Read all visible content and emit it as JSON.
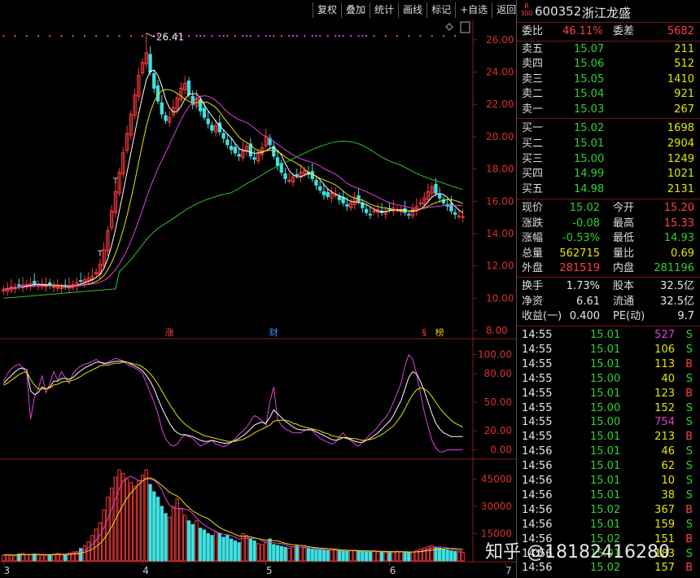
{
  "toolbar": [
    "复权",
    "叠加",
    "统计",
    "画线",
    "标记",
    "+自选",
    "返回"
  ],
  "stock": {
    "market_badge_top": "R",
    "market_badge_bottom": "300",
    "code": "600352",
    "name": "浙江龙盛"
  },
  "order_ratio": {
    "label": "委比",
    "value": "46.11%",
    "diff_label": "委差",
    "diff_value": "5682"
  },
  "asks": [
    {
      "label": "卖五",
      "price": "15.07",
      "vol": "211"
    },
    {
      "label": "卖四",
      "price": "15.06",
      "vol": "512"
    },
    {
      "label": "卖三",
      "price": "15.05",
      "vol": "1410"
    },
    {
      "label": "卖二",
      "price": "15.04",
      "vol": "921"
    },
    {
      "label": "卖一",
      "price": "15.03",
      "vol": "267"
    }
  ],
  "bids": [
    {
      "label": "买一",
      "price": "15.02",
      "vol": "1698"
    },
    {
      "label": "买二",
      "price": "15.01",
      "vol": "2904"
    },
    {
      "label": "买三",
      "price": "15.00",
      "vol": "1249"
    },
    {
      "label": "买四",
      "price": "14.99",
      "vol": "1021"
    },
    {
      "label": "买五",
      "price": "14.98",
      "vol": "2131"
    }
  ],
  "quote": [
    {
      "l1": "现价",
      "v1": "15.02",
      "c1": "green",
      "l2": "今开",
      "v2": "15.20",
      "c2": "red"
    },
    {
      "l1": "涨跌",
      "v1": "-0.08",
      "c1": "green",
      "l2": "最高",
      "v2": "15.33",
      "c2": "red"
    },
    {
      "l1": "涨幅",
      "v1": "-0.53%",
      "c1": "green",
      "l2": "最低",
      "v2": "14.93",
      "c2": "green"
    },
    {
      "l1": "总量",
      "v1": "562715",
      "c1": "yellow",
      "l2": "量比",
      "v2": "0.69",
      "c2": "yellow"
    },
    {
      "l1": "外盘",
      "v1": "281519",
      "c1": "red",
      "l2": "内盘",
      "v2": "281196",
      "c2": "green"
    }
  ],
  "fundamentals": [
    {
      "l1": "换手",
      "v1": "1.73%",
      "l2": "股本",
      "v2": "32.5亿"
    },
    {
      "l1": "净资",
      "v1": "6.61",
      "l2": "流通",
      "v2": "32.5亿"
    },
    {
      "l1": "收益(一)",
      "v1": "0.400",
      "l2": "PE(动)",
      "v2": "9.7"
    }
  ],
  "ticks": [
    {
      "t": "14:55",
      "p": "15.01",
      "v": "527",
      "vc": "magenta",
      "s": "S"
    },
    {
      "t": "14:55",
      "p": "15.01",
      "v": "106",
      "vc": "yellow",
      "s": "S"
    },
    {
      "t": "14:55",
      "p": "15.01",
      "v": "113",
      "vc": "yellow",
      "s": "B"
    },
    {
      "t": "14:55",
      "p": "15.00",
      "v": "40",
      "vc": "yellow",
      "s": "S"
    },
    {
      "t": "14:55",
      "p": "15.01",
      "v": "123",
      "vc": "yellow",
      "s": "B"
    },
    {
      "t": "14:55",
      "p": "15.00",
      "v": "152",
      "vc": "yellow",
      "s": "S"
    },
    {
      "t": "14:55",
      "p": "15.00",
      "v": "754",
      "vc": "magenta",
      "s": "S"
    },
    {
      "t": "14:55",
      "p": "15.01",
      "v": "213",
      "vc": "yellow",
      "s": "B"
    },
    {
      "t": "14:56",
      "p": "15.01",
      "v": "46",
      "vc": "yellow",
      "s": "S"
    },
    {
      "t": "14:56",
      "p": "15.01",
      "v": "62",
      "vc": "yellow",
      "s": "S"
    },
    {
      "t": "14:56",
      "p": "15.01",
      "v": "10",
      "vc": "yellow",
      "s": "S"
    },
    {
      "t": "14:56",
      "p": "15.01",
      "v": "38",
      "vc": "yellow",
      "s": "S"
    },
    {
      "t": "14:56",
      "p": "15.02",
      "v": "367",
      "vc": "yellow",
      "s": "B"
    },
    {
      "t": "14:56",
      "p": "15.01",
      "v": "159",
      "vc": "yellow",
      "s": "S"
    },
    {
      "t": "14:56",
      "p": "15.02",
      "v": "151",
      "vc": "yellow",
      "s": "B"
    },
    {
      "t": "14:56",
      "p": "15.01",
      "v": "183",
      "vc": "yellow",
      "s": "S"
    },
    {
      "t": "14:56",
      "p": "15.02",
      "v": "157",
      "vc": "yellow",
      "s": "B"
    }
  ],
  "watermark": "知乎 @18182416280",
  "colors": {
    "up": "#ff3a3a",
    "down": "#3ee0e0",
    "bid_green": "#2fd12f",
    "frame_red": "#8a1a1a",
    "ma5": "#ffffff",
    "ma10": "#e6e600",
    "ma20": "#e040e0",
    "ma60": "#2fc02f"
  },
  "chart_data": [
    {
      "type": "candlestick",
      "name": "price",
      "yticks": [
        "26.00",
        "24.00",
        "22.00",
        "20.00",
        "18.00",
        "16.00",
        "14.00",
        "12.00",
        "10.00",
        "8.00"
      ],
      "ylim": [
        7.6,
        27.2
      ],
      "x_labels": [
        "3",
        "4",
        "5",
        "6",
        "7"
      ],
      "x_label_index": [
        0,
        36,
        68,
        100,
        130
      ],
      "max_annotation": "26.41",
      "event_labels": [
        {
          "i": 43,
          "text": "涨",
          "color": "#ff4040"
        },
        {
          "i": 70,
          "text": "财",
          "color": "#4090ff"
        },
        {
          "i": 109,
          "text": "§",
          "color": "#ff4040"
        },
        {
          "i": 113,
          "text": "榜",
          "color": "#e6c000"
        }
      ],
      "t_marks": [
        25,
        29
      ],
      "close": [
        10.55,
        10.62,
        10.7,
        10.68,
        10.75,
        10.82,
        10.85,
        10.9,
        10.88,
        10.86,
        10.82,
        10.8,
        10.78,
        10.72,
        10.7,
        10.66,
        10.72,
        10.78,
        10.85,
        10.95,
        11.05,
        11.15,
        11.25,
        11.35,
        11.6,
        12.1,
        13.0,
        14.2,
        15.4,
        16.6,
        17.8,
        19.0,
        20.2,
        21.4,
        22.6,
        23.8,
        24.6,
        25.2,
        24.0,
        23.0,
        22.2,
        21.4,
        21.0,
        21.2,
        21.8,
        22.4,
        23.0,
        23.3,
        22.6,
        22.0,
        22.4,
        21.6,
        21.2,
        20.8,
        20.4,
        20.7,
        20.3,
        19.9,
        19.5,
        19.2,
        19.0,
        18.8,
        19.2,
        19.4,
        18.8,
        18.6,
        19.0,
        19.3,
        20.0,
        19.5,
        18.8,
        18.2,
        17.8,
        17.4,
        17.3,
        17.5,
        17.6,
        17.8,
        17.9,
        17.7,
        17.4,
        17.0,
        16.7,
        16.4,
        16.3,
        16.5,
        16.4,
        16.1,
        15.9,
        15.7,
        15.9,
        16.2,
        16.0,
        15.6,
        15.3,
        15.2,
        15.4,
        15.5,
        15.3,
        15.4,
        15.5,
        15.6,
        15.5,
        15.4,
        15.3,
        15.2,
        15.5,
        15.7,
        15.9,
        16.2,
        16.6,
        16.9,
        16.5,
        16.2,
        15.9,
        15.7,
        15.4,
        15.2,
        15.1,
        15.05
      ],
      "volume_yticks": [
        "45000",
        "30000",
        "15000"
      ],
      "volume_ylim": [
        0,
        55000
      ],
      "volume": [
        3200,
        3500,
        3100,
        2900,
        3800,
        4100,
        3600,
        3300,
        3900,
        3500,
        3200,
        3000,
        3400,
        3700,
        4100,
        3800,
        3500,
        4200,
        4900,
        5200,
        6800,
        8200,
        10500,
        14000,
        17500,
        21000,
        28000,
        35000,
        40000,
        46000,
        50000,
        48000,
        45000,
        43000,
        41000,
        44000,
        47000,
        50000,
        42000,
        38000,
        35000,
        30000,
        26000,
        24000,
        30000,
        34000,
        29000,
        25000,
        22000,
        20000,
        22000,
        18000,
        17000,
        15000,
        14000,
        16000,
        15000,
        13000,
        14000,
        12000,
        11000,
        10000,
        15000,
        14000,
        12000,
        11000,
        9500,
        9000,
        10000,
        12000,
        9000,
        8500,
        8000,
        7500,
        7000,
        7800,
        8200,
        7600,
        7200,
        6800,
        6500,
        6200,
        6000,
        5800,
        5600,
        5900,
        6100,
        5700,
        5500,
        5300,
        5600,
        5900,
        5400,
        5100,
        4900,
        5200,
        5500,
        5000,
        4800,
        4600,
        4800,
        5100,
        5300,
        5000,
        4700,
        4500,
        4900,
        5800,
        6400,
        7100,
        7900,
        8500,
        7600,
        7000,
        6500,
        6000,
        5600,
        5200,
        4900,
        4700
      ],
      "series": [
        {
          "name": "MA5",
          "color": "#ffffff"
        },
        {
          "name": "MA10",
          "color": "#e6e600"
        },
        {
          "name": "MA20",
          "color": "#e040e0"
        },
        {
          "name": "MA60",
          "color": "#2fc02f"
        }
      ]
    },
    {
      "type": "line",
      "name": "oscillator",
      "yticks": [
        "100.00",
        "80.00",
        "50.00",
        "20.00",
        "0.00"
      ],
      "ylim": [
        -8,
        115
      ],
      "series": [
        {
          "color": "#e040e0",
          "values": [
            72,
            80,
            85,
            88,
            90,
            86,
            80,
            32,
            55,
            64,
            78,
            60,
            70,
            82,
            73,
            82,
            76,
            70,
            80,
            85,
            88,
            90,
            91,
            93,
            95,
            92,
            90,
            92,
            94,
            96,
            95,
            93,
            90,
            88,
            86,
            84,
            80,
            70,
            60,
            50,
            38,
            22,
            12,
            6,
            4,
            6,
            12,
            16,
            14,
            12,
            8,
            4,
            6,
            8,
            10,
            6,
            5,
            3,
            5,
            8,
            12,
            16,
            20,
            24,
            30,
            36,
            34,
            30,
            26,
            50,
            66,
            32,
            26,
            22,
            20,
            18,
            18,
            18,
            20,
            22,
            20,
            16,
            12,
            10,
            8,
            6,
            8,
            14,
            18,
            12,
            10,
            6,
            4,
            8,
            12,
            16,
            20,
            24,
            30,
            34,
            40,
            50,
            60,
            70,
            88,
            100,
            95,
            80,
            60,
            40,
            24,
            10,
            2,
            -2,
            -2,
            0,
            0,
            0,
            0,
            0
          ]
        },
        {
          "color": "#ffffff",
          "values": [
            70,
            74,
            78,
            82,
            85,
            86,
            84,
            62,
            58,
            60,
            66,
            64,
            66,
            72,
            72,
            75,
            75,
            74,
            76,
            80,
            83,
            86,
            88,
            90,
            92,
            92,
            91,
            91,
            92,
            93,
            93,
            93,
            92,
            90,
            88,
            86,
            83,
            78,
            72,
            64,
            54,
            44,
            36,
            28,
            22,
            18,
            16,
            16,
            15,
            14,
            12,
            10,
            9,
            9,
            10,
            9,
            8,
            7,
            7,
            8,
            10,
            12,
            15,
            18,
            22,
            26,
            28,
            29,
            28,
            34,
            42,
            38,
            34,
            30,
            27,
            24,
            22,
            21,
            21,
            21,
            21,
            19,
            17,
            15,
            13,
            11,
            10,
            11,
            13,
            12,
            11,
            9,
            8,
            8,
            10,
            12,
            15,
            18,
            22,
            26,
            30,
            36,
            44,
            52,
            64,
            76,
            82,
            80,
            72,
            62,
            50,
            38,
            28,
            22,
            18,
            16,
            14,
            14,
            14,
            14
          ]
        },
        {
          "color": "#e6e600",
          "values": [
            68,
            70,
            73,
            76,
            79,
            81,
            82,
            74,
            68,
            64,
            64,
            64,
            65,
            68,
            69,
            71,
            72,
            72,
            73,
            75,
            77,
            80,
            82,
            84,
            86,
            88,
            89,
            89,
            90,
            91,
            91,
            92,
            92,
            91,
            90,
            89,
            87,
            84,
            80,
            75,
            69,
            62,
            55,
            48,
            42,
            36,
            31,
            27,
            24,
            21,
            19,
            17,
            15,
            14,
            13,
            12,
            11,
            10,
            9,
            9,
            9,
            10,
            11,
            13,
            15,
            18,
            20,
            22,
            24,
            26,
            30,
            31,
            31,
            31,
            30,
            28,
            27,
            25,
            24,
            23,
            22,
            21,
            20,
            18,
            17,
            15,
            14,
            13,
            13,
            13,
            12,
            12,
            11,
            10,
            10,
            11,
            12,
            14,
            16,
            19,
            22,
            25,
            30,
            36,
            43,
            51,
            58,
            63,
            65,
            64,
            61,
            56,
            50,
            44,
            39,
            35,
            31,
            28,
            26,
            24
          ]
        }
      ]
    }
  ]
}
